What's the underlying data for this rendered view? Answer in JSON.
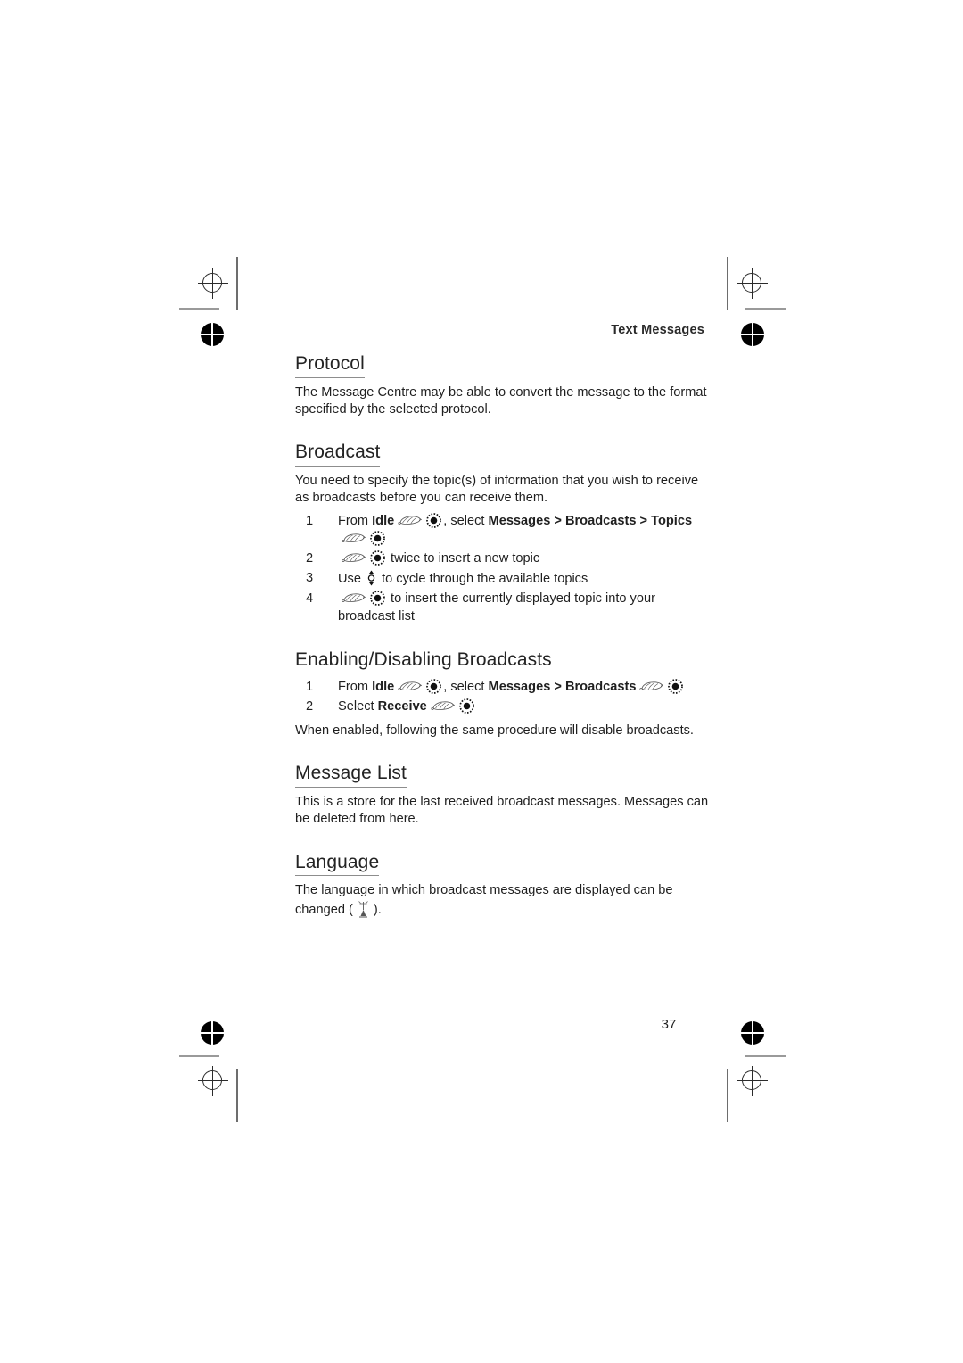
{
  "page": {
    "header": "Text Messages",
    "number": "37"
  },
  "icons": {
    "softkey": "softkey-press-icon",
    "select": "select-button-icon",
    "scroll": "scroll-updown-key-icon",
    "language": "language-key-icon"
  },
  "sections": [
    {
      "heading": "Protocol",
      "paragraphs": [
        "The Message Centre may be able to convert the message to the format specified by the selected protocol."
      ],
      "steps": []
    },
    {
      "heading": "Broadcast",
      "paragraphs": [
        "You need to specify the topic(s) of information that you wish to receive as broadcasts before you can receive them."
      ],
      "steps": [
        {
          "number": "1",
          "parts": [
            {
              "type": "text",
              "value": "From "
            },
            {
              "type": "bold",
              "value": "Idle"
            },
            {
              "type": "icon",
              "value": "softkey"
            },
            {
              "type": "icon",
              "value": "select"
            },
            {
              "type": "text",
              "value": ", select "
            },
            {
              "type": "bold",
              "value": "Messages"
            },
            {
              "type": "bold",
              "value": " > "
            },
            {
              "type": "bold",
              "value": "Broadcasts"
            },
            {
              "type": "bold",
              "value": " > "
            },
            {
              "type": "bold",
              "value": "Topics"
            },
            {
              "type": "icon",
              "value": "softkey"
            },
            {
              "type": "icon",
              "value": "select"
            }
          ]
        },
        {
          "number": "2",
          "parts": [
            {
              "type": "icon",
              "value": "softkey"
            },
            {
              "type": "icon",
              "value": "select"
            },
            {
              "type": "text",
              "value": " twice to insert a new topic"
            }
          ]
        },
        {
          "number": "3",
          "parts": [
            {
              "type": "text",
              "value": "Use "
            },
            {
              "type": "icon",
              "value": "scroll"
            },
            {
              "type": "text",
              "value": " to cycle through the available topics"
            }
          ]
        },
        {
          "number": "4",
          "parts": [
            {
              "type": "icon",
              "value": "softkey"
            },
            {
              "type": "icon",
              "value": "select"
            },
            {
              "type": "text",
              "value": " to insert the currently displayed topic into your broadcast list"
            }
          ]
        }
      ]
    },
    {
      "heading": "Enabling/Disabling Broadcasts",
      "paragraphs": [],
      "steps": [
        {
          "number": "1",
          "parts": [
            {
              "type": "text",
              "value": "From "
            },
            {
              "type": "bold",
              "value": "Idle"
            },
            {
              "type": "icon",
              "value": "softkey"
            },
            {
              "type": "icon",
              "value": "select"
            },
            {
              "type": "text",
              "value": ", select "
            },
            {
              "type": "bold",
              "value": "Messages"
            },
            {
              "type": "bold",
              "value": " > "
            },
            {
              "type": "bold",
              "value": "Broadcasts"
            },
            {
              "type": "icon",
              "value": "softkey"
            },
            {
              "type": "icon",
              "value": "select"
            }
          ]
        },
        {
          "number": "2",
          "parts": [
            {
              "type": "text",
              "value": "Select "
            },
            {
              "type": "bold",
              "value": "Receive"
            },
            {
              "type": "icon",
              "value": "softkey"
            },
            {
              "type": "icon",
              "value": "select"
            }
          ]
        }
      ],
      "trailing_paragraphs": [
        "When enabled, following the same procedure will disable broadcasts."
      ]
    },
    {
      "heading": "Message List",
      "paragraphs": [
        "This is a store for the last received broadcast messages. Messages can be deleted from here."
      ],
      "steps": []
    },
    {
      "heading": "Language",
      "paragraphs": [],
      "steps": [],
      "rich_paragraph": [
        {
          "type": "text",
          "value": "The language in which broadcast messages are displayed can be changed ("
        },
        {
          "type": "icon",
          "value": "language"
        },
        {
          "type": "text",
          "value": ")."
        }
      ]
    }
  ]
}
